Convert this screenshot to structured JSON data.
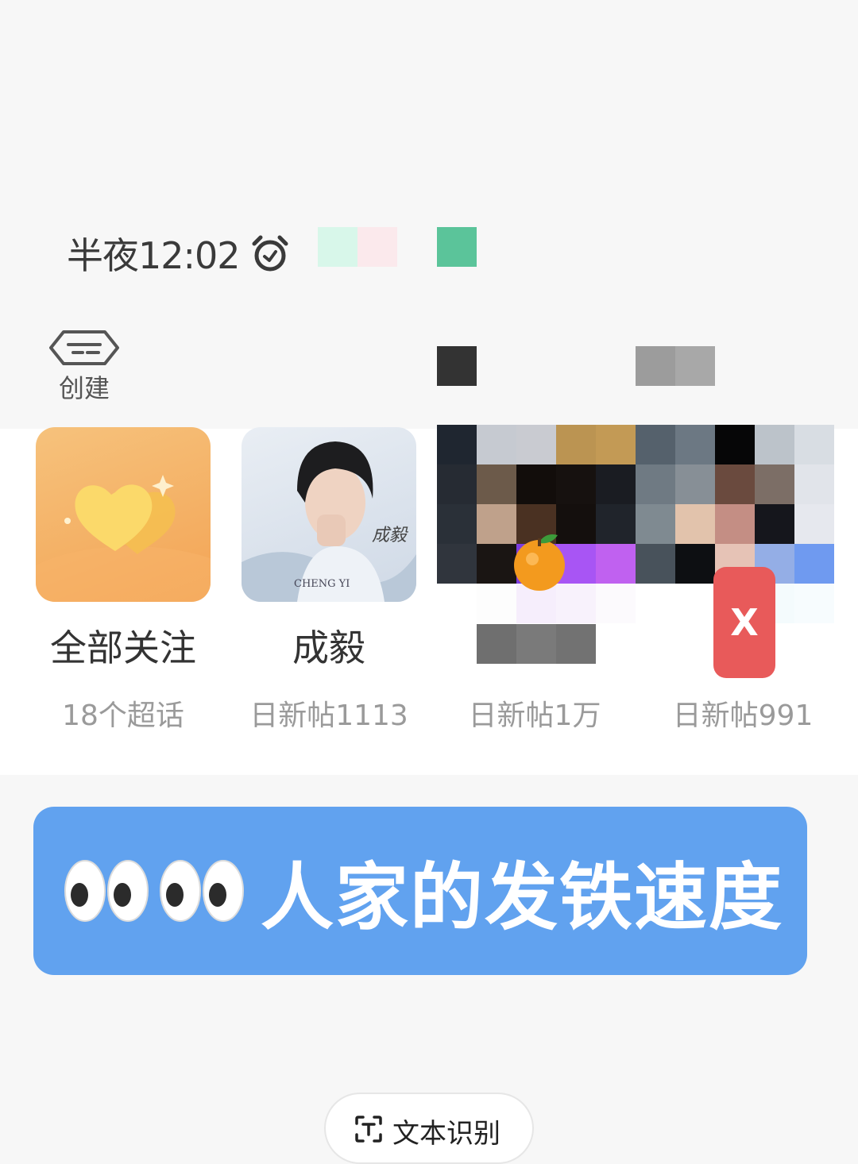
{
  "status_bar": {
    "time": "半夜12:02",
    "alarm_icon": "alarm-clock-icon"
  },
  "toolbar": {
    "create_label": "创建",
    "create_icon": "create-tag-icon"
  },
  "supertopics": [
    {
      "name": "全部关注",
      "subtitle": "18个超话",
      "icon": "heart-icon"
    },
    {
      "name": "成毅",
      "subtitle": "日新帖1113",
      "cover_text": "成毅",
      "cover_caption": "CHENG YI"
    },
    {
      "name": "",
      "subtitle": "日新帖1万"
    },
    {
      "name": "",
      "subtitle": "日新帖991"
    }
  ],
  "close_button": {
    "label": "X"
  },
  "banner": {
    "emoji": "👀👀",
    "text": "人家的发铁速度",
    "color": "#61a2ef"
  },
  "ocr_button": {
    "label": "文本识别",
    "icon": "text-scan-icon"
  },
  "colors": {
    "accent_blue": "#61a2ef",
    "close_red": "#e85a5a",
    "orange_card": "#f3a455"
  }
}
